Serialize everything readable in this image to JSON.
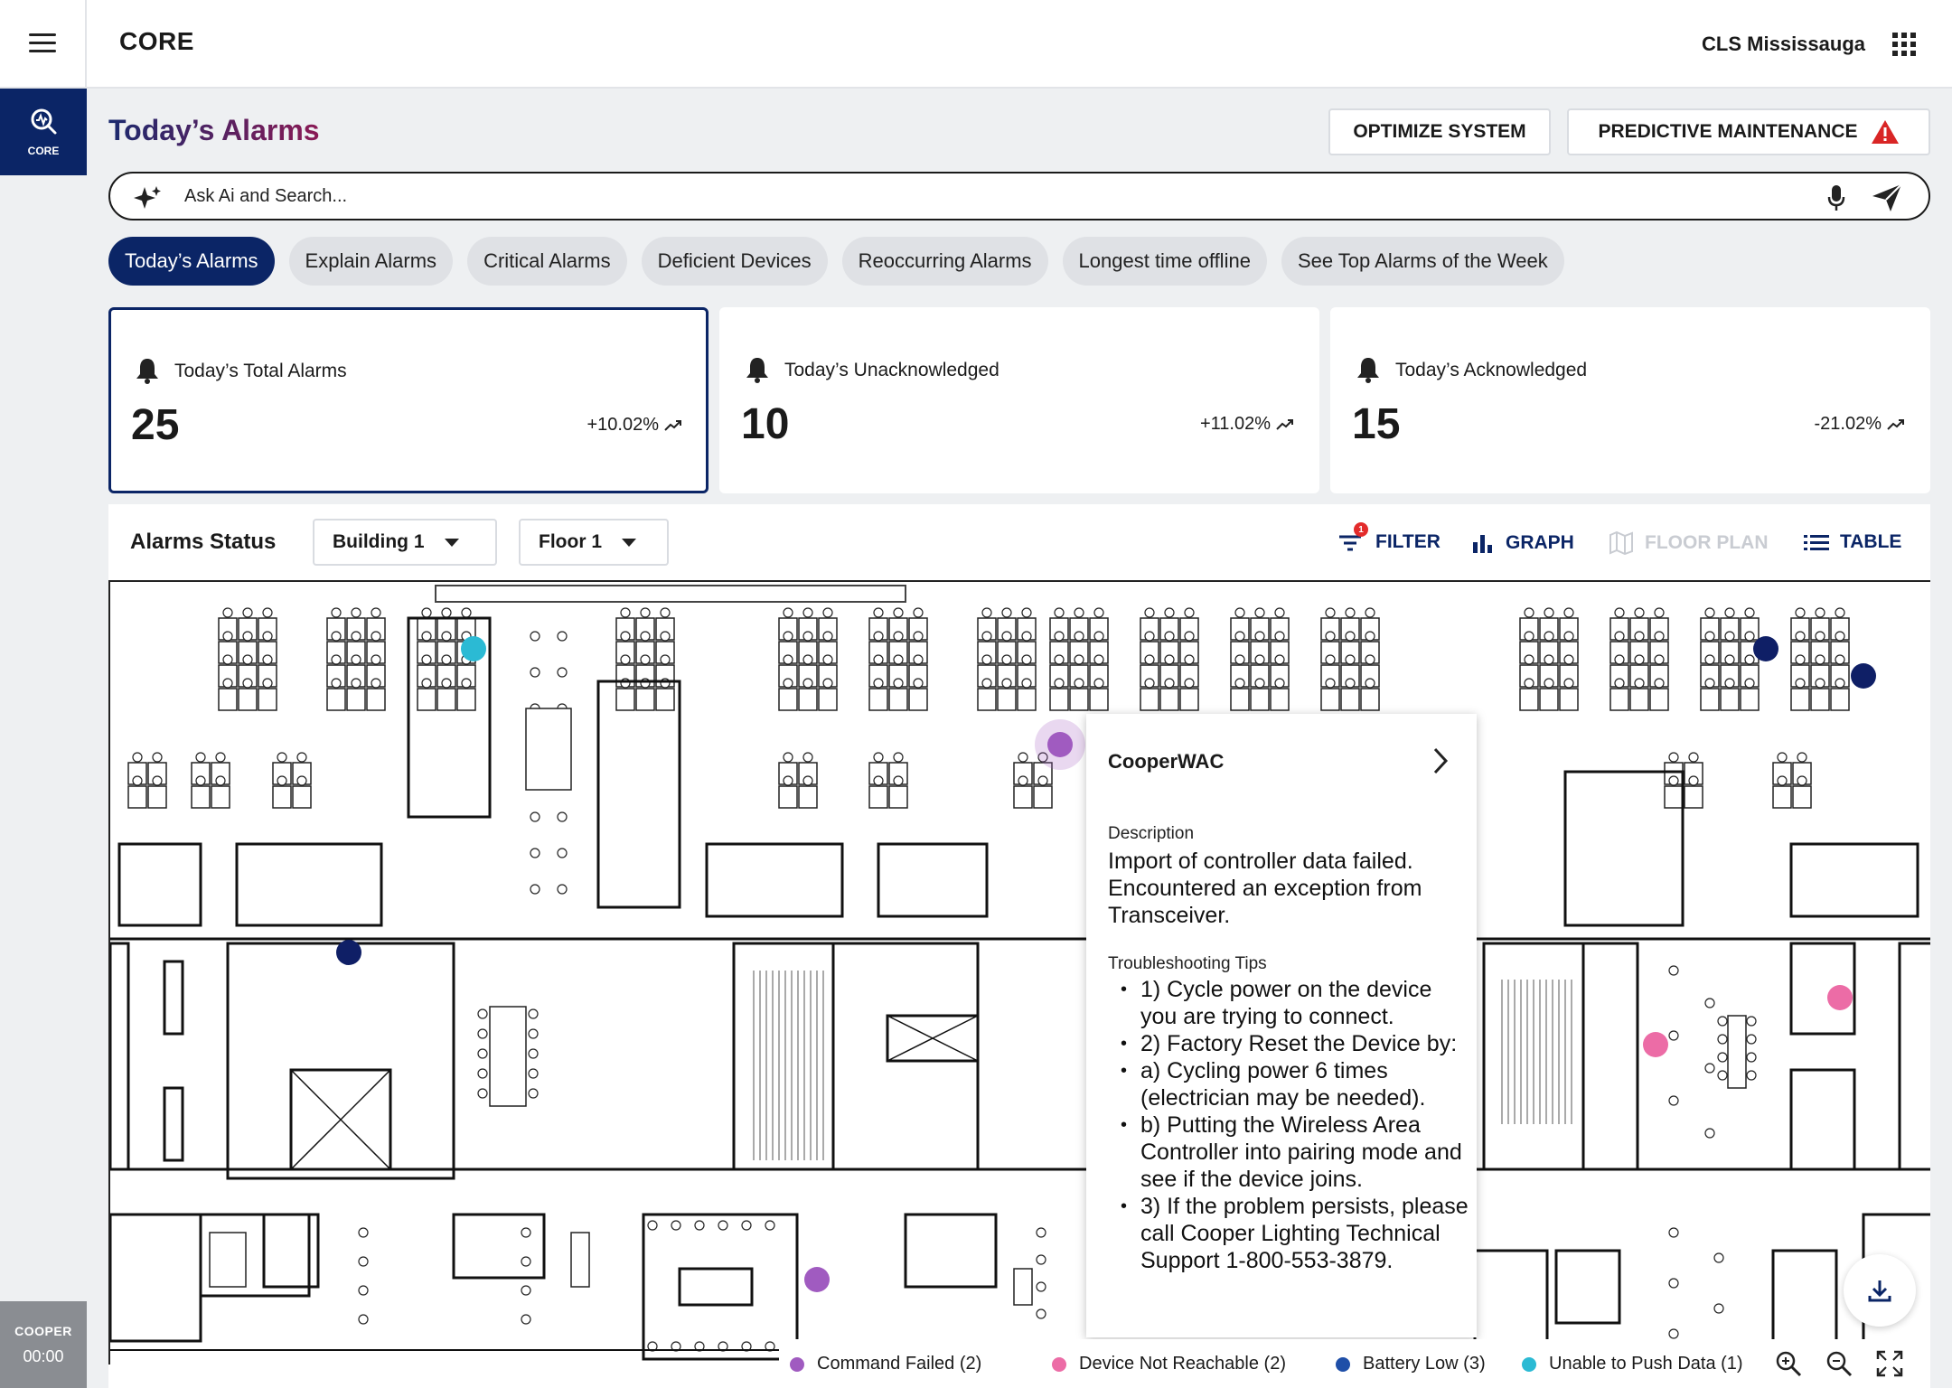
{
  "header": {
    "app_title": "CORE",
    "site_name": "CLS Mississauga"
  },
  "sidebar": {
    "core_label": "CORE",
    "brand": "COOPER",
    "time": "00:00"
  },
  "page": {
    "title": "Today’s Alarms",
    "optimize_label": "OPTIMIZE SYSTEM",
    "predictive_label": "PREDICTIVE MAINTENANCE"
  },
  "search": {
    "placeholder": "Ask Ai and Search..."
  },
  "chips": [
    {
      "label": "Today’s Alarms",
      "active": true
    },
    {
      "label": "Explain Alarms",
      "active": false
    },
    {
      "label": "Critical Alarms",
      "active": false
    },
    {
      "label": "Deficient Devices",
      "active": false
    },
    {
      "label": "Reoccurring Alarms",
      "active": false
    },
    {
      "label": "Longest time offline",
      "active": false
    },
    {
      "label": "See Top Alarms of the Week",
      "active": false
    }
  ],
  "cards": [
    {
      "label": "Today’s Total Alarms",
      "value": "25",
      "delta": "+10.02%"
    },
    {
      "label": "Today’s Unacknowledged",
      "value": "10",
      "delta": "+11.02%"
    },
    {
      "label": "Today’s Acknowledged",
      "value": "15",
      "delta": "-21.02%"
    }
  ],
  "status": {
    "title": "Alarms Status",
    "building": "Building 1",
    "floor": "Floor 1",
    "filter_label": "FILTER",
    "filter_count": "1",
    "graph_label": "GRAPH",
    "floorplan_label": "FLOOR PLAN",
    "table_label": "TABLE"
  },
  "popup": {
    "title": "CooperWAC",
    "description_label": "Description",
    "description": "Import of controller data failed. Encountered an exception from Transceiver.",
    "tips_label": "Troubleshooting Tips",
    "tips": [
      "1) Cycle power on the device you are trying to connect.",
      "2) Factory Reset the Device by:",
      "a) Cycling power 6 times (electrician may be needed).",
      "b) Putting the Wireless Area Controller into pairing mode and see if the device joins.",
      "3) If the problem persists, please call Cooper Lighting Technical Support 1-800-553-3879."
    ]
  },
  "legend": [
    {
      "label": "Command Failed (2)",
      "color": "#a05bc0"
    },
    {
      "label": "Device Not Reachable (2)",
      "color": "#ec6ca6"
    },
    {
      "label": "Battery Low (3)",
      "color": "#1f4fa8"
    },
    {
      "label": "Unable to Push Data (1)",
      "color": "#2bbad4"
    }
  ],
  "colors": {
    "primary": "#0b2566",
    "warning": "#d92525",
    "command_failed": "#a05bc0",
    "not_reachable": "#ec6ca6",
    "battery_low": "#0f1f66",
    "push_failed": "#2bbad4"
  }
}
